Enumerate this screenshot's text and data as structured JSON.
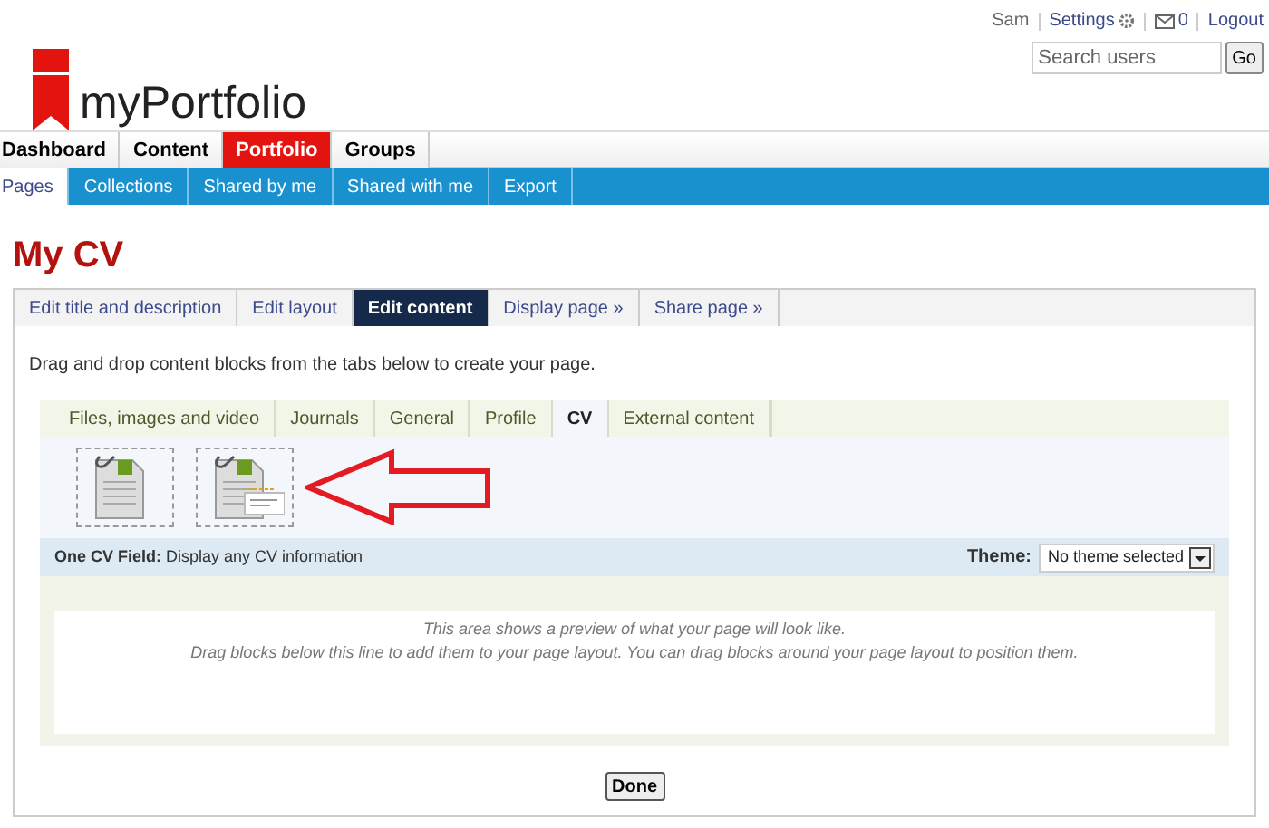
{
  "header": {
    "logo_text": "myPortfolio",
    "user_links": [
      {
        "kind": "text",
        "label": "Sam"
      },
      {
        "kind": "settings",
        "label": "Settings"
      },
      {
        "kind": "inbox",
        "label": "0"
      },
      {
        "kind": "text",
        "label": "Logout"
      }
    ],
    "search": {
      "placeholder": "Search users",
      "button": "Go"
    }
  },
  "main_nav": [
    {
      "label": "Dashboard",
      "selected": false
    },
    {
      "label": "Content",
      "selected": false
    },
    {
      "label": "Portfolio",
      "selected": true
    },
    {
      "label": "Groups",
      "selected": false
    }
  ],
  "sub_nav": [
    {
      "label": "Pages",
      "selected": true
    },
    {
      "label": "Collections",
      "selected": false
    },
    {
      "label": "Shared by me",
      "selected": false
    },
    {
      "label": "Shared with me",
      "selected": false
    },
    {
      "label": "Export",
      "selected": false
    }
  ],
  "page_title": "My CV",
  "edit_tabs": [
    {
      "label": "Edit title and description",
      "selected": false
    },
    {
      "label": "Edit layout",
      "selected": false
    },
    {
      "label": "Edit content",
      "selected": true
    },
    {
      "label": "Display page »",
      "selected": false
    },
    {
      "label": "Share page »",
      "selected": false
    }
  ],
  "instructions": "Drag and drop content blocks from the tabs below to create your page.",
  "block_tabs": [
    {
      "label": "Files, images and video",
      "selected": false
    },
    {
      "label": "Journals",
      "selected": false
    },
    {
      "label": "General",
      "selected": false
    },
    {
      "label": "Profile",
      "selected": false
    },
    {
      "label": "CV",
      "selected": true
    },
    {
      "label": "External content",
      "selected": false
    }
  ],
  "blocks": [
    {
      "kind": "document"
    },
    {
      "kind": "field"
    }
  ],
  "block_info": "**One CV Field:** Display any CV information",
  "theme": {
    "label": "Theme:",
    "value": "No theme selected"
  },
  "preview_text": [
    "This area shows a preview of what your page will look like.",
    "Drag blocks below this line to add them to your page layout. You can drag blocks around your page layout to position them."
  ],
  "done_button": "Done"
}
